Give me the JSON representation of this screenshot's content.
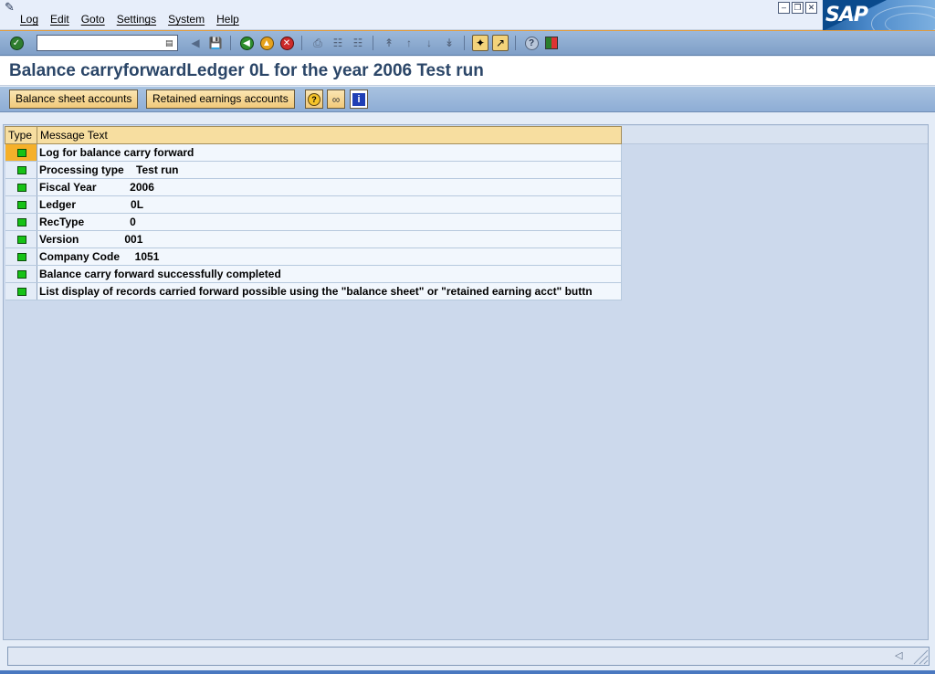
{
  "menu": {
    "items": [
      "Log",
      "Edit",
      "Goto",
      "Settings",
      "System",
      "Help"
    ]
  },
  "logo": "SAP",
  "command_field": {
    "value": ""
  },
  "title": "Balance carryforwardLedger 0L for the year 2006 Test run",
  "app_toolbar": {
    "balance_sheet_label": "Balance sheet accounts",
    "retained_earnings_label": "Retained earnings accounts"
  },
  "grid": {
    "headers": {
      "type": "Type",
      "message": "Message Text"
    },
    "rows": [
      {
        "type": "green",
        "text": "Log for balance carry forward"
      },
      {
        "type": "green",
        "text": "Processing type    Test run"
      },
      {
        "type": "green",
        "text": "Fiscal Year           2006"
      },
      {
        "type": "green",
        "text": "Ledger                  0L"
      },
      {
        "type": "green",
        "text": "RecType               0"
      },
      {
        "type": "green",
        "text": "Version               001"
      },
      {
        "type": "green",
        "text": "Company Code     1051"
      },
      {
        "type": "green",
        "text": "Balance carry forward successfully completed"
      },
      {
        "type": "green",
        "text": "List display of records carried forward possible using the \"balance sheet\" or \"retained earning acct\" buttn"
      }
    ]
  },
  "colors": {
    "led_green": "#16c216",
    "selected_row": "#f5b02a",
    "title_text": "#2b4668",
    "button_face": "#f1c97a"
  },
  "icons": {
    "enter": "check-icon",
    "save": "save-icon",
    "back": "back-icon",
    "exit": "exit-icon",
    "cancel": "cancel-icon",
    "print": "print-icon",
    "find": "find-icon",
    "find_next": "find-next-icon",
    "first_page": "first-page-icon",
    "prev_page": "previous-page-icon",
    "next_page": "next-page-icon",
    "last_page": "last-page-icon",
    "new_session": "new-session-icon",
    "shortcut": "shortcut-icon",
    "help": "help-icon",
    "layout": "customize-layout-icon"
  }
}
